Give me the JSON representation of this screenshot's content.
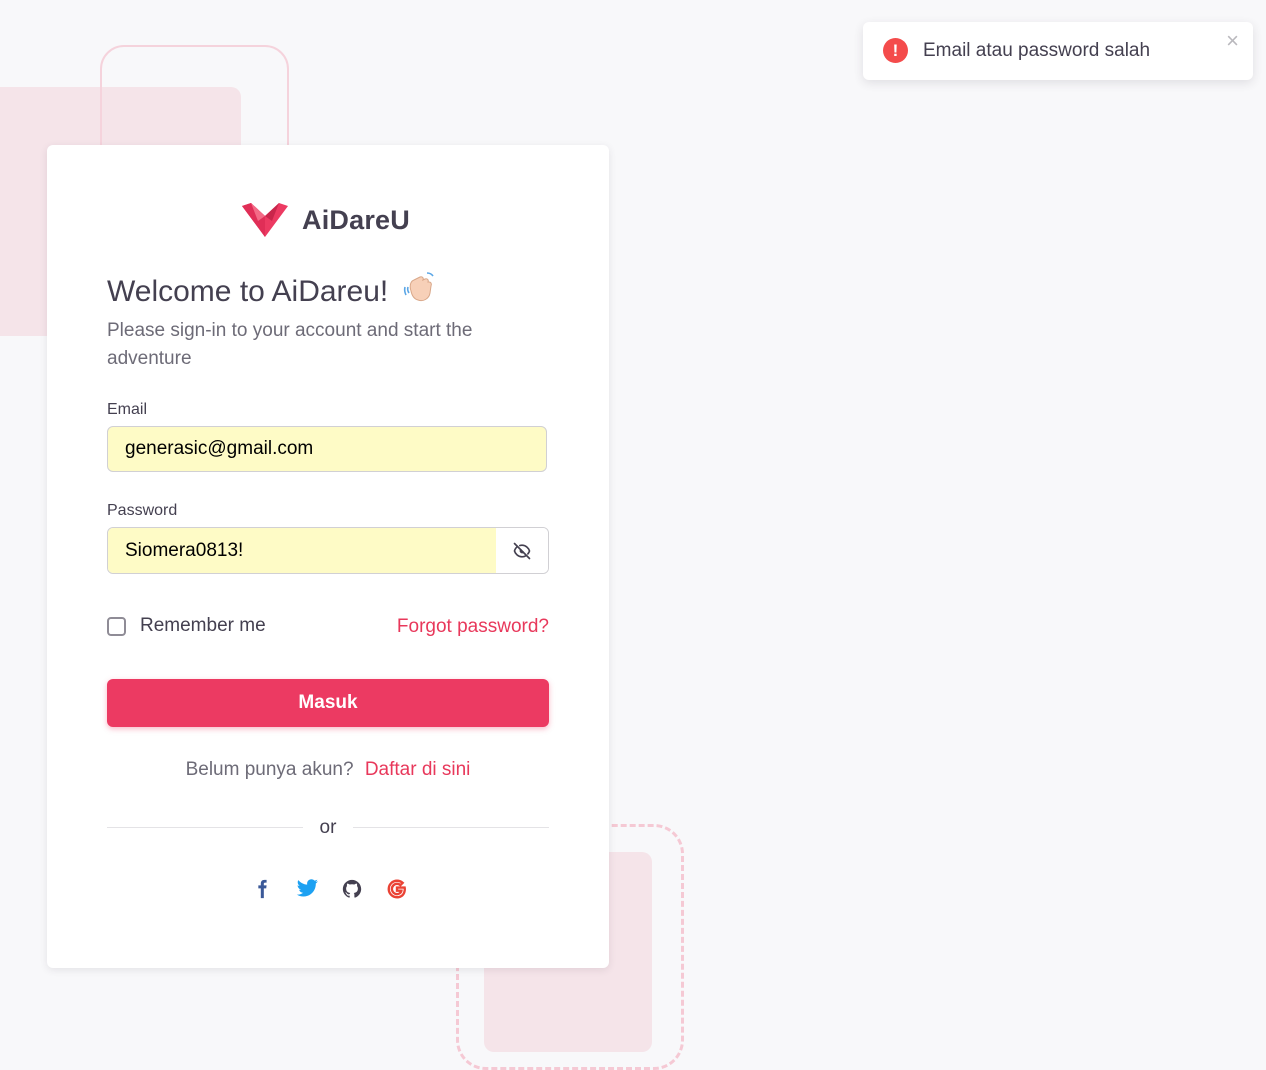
{
  "brand": {
    "name": "AiDareU",
    "color": "#ec3a62"
  },
  "welcome": {
    "title": "Welcome to AiDareu!",
    "emoji": "wave-hand",
    "subtitle": "Please sign-in to your account and start the adventure"
  },
  "form": {
    "email_label": "Email",
    "email_value": "generasic@gmail.com",
    "password_label": "Password",
    "password_value": "Siomera0813!",
    "password_toggle_icon": "eye-off-icon",
    "remember_label": "Remember me",
    "remember_checked": false,
    "forgot_label": "Forgot password?",
    "submit_label": "Masuk"
  },
  "signup": {
    "text": "Belum punya akun?",
    "link": "Daftar di sini"
  },
  "divider_text": "or",
  "socials": [
    "facebook-icon",
    "twitter-icon",
    "github-icon",
    "google-icon"
  ],
  "toast": {
    "type": "error",
    "icon": "!",
    "message": "Email atau password salah",
    "close": "×",
    "color": "#f44b4b"
  },
  "colors": {
    "accent": "#ec3a62",
    "autofill": "#fefbc6",
    "background": "#f8f8fa"
  }
}
